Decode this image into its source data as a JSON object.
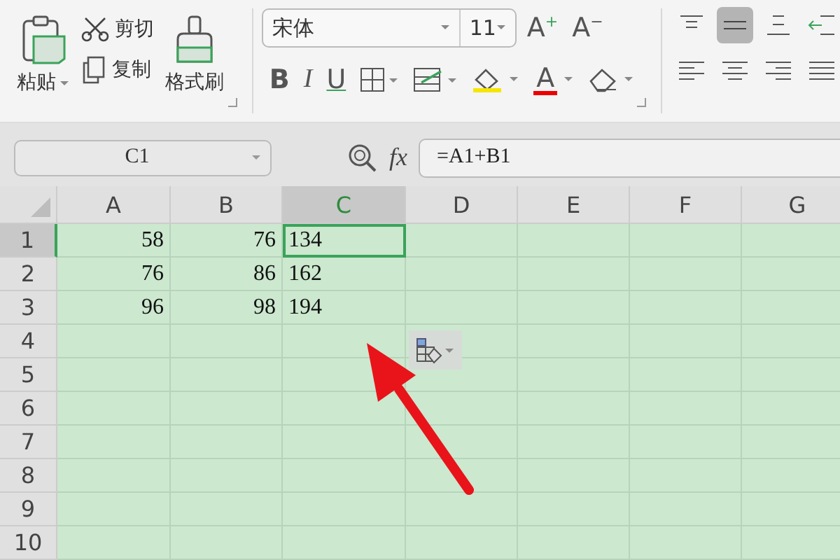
{
  "ribbon": {
    "clipboard": {
      "paste": "粘贴",
      "cut": "剪切",
      "copy": "复制",
      "format_painter": "格式刷"
    },
    "font": {
      "name": "宋体",
      "size": "11",
      "size_buttons": [
        {
          "label": "A",
          "sign": "+"
        },
        {
          "label": "A",
          "sign": "−"
        }
      ],
      "buttons": [
        {
          "kind": "bold",
          "label": "B"
        },
        {
          "kind": "italic",
          "label": "I"
        },
        {
          "kind": "underline",
          "label": "U"
        },
        {
          "kind": "borders"
        },
        {
          "kind": "cellstyle"
        },
        {
          "kind": "fill"
        },
        {
          "kind": "fontcolor",
          "label": "A"
        },
        {
          "kind": "clear"
        }
      ]
    },
    "alignment": {
      "vertical": [
        {
          "kind": "top",
          "selected": false
        },
        {
          "kind": "middle",
          "selected": true
        },
        {
          "kind": "bottom",
          "selected": false
        },
        {
          "kind": "indent",
          "selected": false
        }
      ],
      "horizontal": [
        {
          "kind": "left",
          "selected": false
        },
        {
          "kind": "center",
          "selected": false
        },
        {
          "kind": "right",
          "selected": false
        },
        {
          "kind": "justify",
          "selected": false
        }
      ]
    }
  },
  "formula_bar": {
    "name_box": "C1",
    "fx": "fx",
    "formula": "=A1+B1"
  },
  "sheet": {
    "columns": [
      {
        "label": "A",
        "selected": false
      },
      {
        "label": "B",
        "selected": false
      },
      {
        "label": "C",
        "selected": true
      },
      {
        "label": "D",
        "selected": false
      },
      {
        "label": "E",
        "selected": false
      },
      {
        "label": "F",
        "selected": false
      },
      {
        "label": "G",
        "selected": false
      }
    ],
    "rows": [
      {
        "label": "1",
        "selected": true,
        "cells": [
          {
            "value": "58",
            "left_aligned": false,
            "selected": false
          },
          {
            "value": "76",
            "left_aligned": false,
            "selected": false
          },
          {
            "value": "134",
            "left_aligned": true,
            "selected": true
          }
        ]
      },
      {
        "label": "2",
        "selected": false,
        "cells": [
          {
            "value": "76",
            "left_aligned": false,
            "selected": false
          },
          {
            "value": "86",
            "left_aligned": false,
            "selected": false
          },
          {
            "value": "162",
            "left_aligned": true,
            "selected": false
          }
        ]
      },
      {
        "label": "3",
        "selected": false,
        "cells": [
          {
            "value": "96",
            "left_aligned": false,
            "selected": false
          },
          {
            "value": "98",
            "left_aligned": false,
            "selected": false
          },
          {
            "value": "194",
            "left_aligned": true,
            "selected": false
          }
        ]
      },
      {
        "label": "4",
        "selected": false
      },
      {
        "label": "5",
        "selected": false
      },
      {
        "label": "6",
        "selected": false
      },
      {
        "label": "7",
        "selected": false
      },
      {
        "label": "8",
        "selected": false
      },
      {
        "label": "9",
        "selected": false
      },
      {
        "label": "10",
        "selected": false
      }
    ]
  }
}
